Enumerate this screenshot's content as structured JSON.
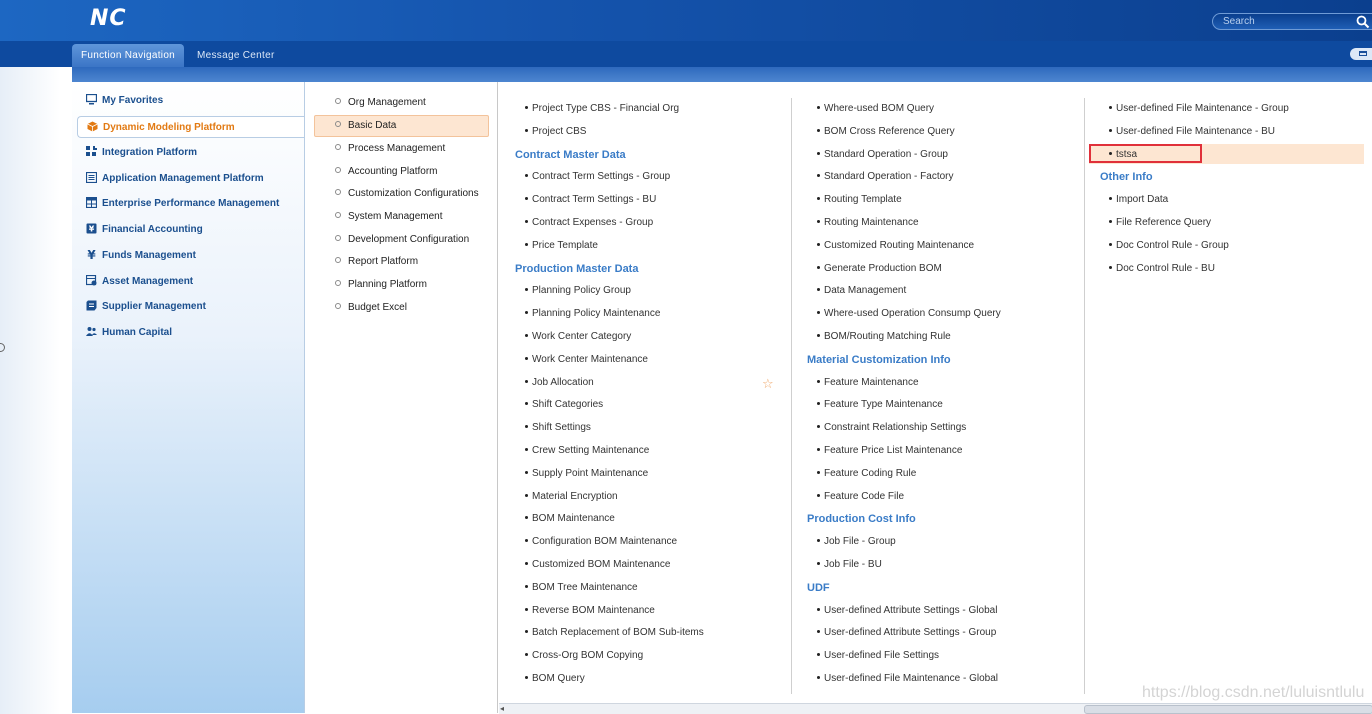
{
  "header": {
    "logo": "NC",
    "search": {
      "placeholder": "Search"
    }
  },
  "tabs": [
    {
      "label": "Function Navigation",
      "active": true
    },
    {
      "label": "Message Center",
      "active": false
    }
  ],
  "sidebar": {
    "items": [
      {
        "label": "My Favorites",
        "icon": "monitor-icon"
      },
      {
        "label": "Dynamic Modeling Platform",
        "icon": "cube-icon",
        "active": true
      },
      {
        "label": "Integration Platform",
        "icon": "integration-icon"
      },
      {
        "label": "Application Management Platform",
        "icon": "app-grid-icon"
      },
      {
        "label": "Enterprise Performance Management",
        "icon": "table-icon"
      },
      {
        "label": "Financial Accounting",
        "icon": "ledger-icon"
      },
      {
        "label": "Funds Management",
        "icon": "yen-icon"
      },
      {
        "label": "Asset Management",
        "icon": "asset-icon"
      },
      {
        "label": "Supplier Management",
        "icon": "supplier-icon"
      },
      {
        "label": "Human Capital",
        "icon": "people-icon"
      }
    ]
  },
  "subnav": {
    "items": [
      "Org Management",
      "Basic Data",
      "Process Management",
      "Accounting Platform",
      "Customization Configurations",
      "System Management",
      "Development Configuration",
      "Report Platform",
      "Planning Platform",
      "Budget Excel"
    ],
    "active_index": 1
  },
  "content": {
    "col1": [
      {
        "type": "item",
        "text": "Project Type CBS - Financial Org"
      },
      {
        "type": "item",
        "text": "Project CBS"
      },
      {
        "type": "head",
        "text": "Contract Master Data"
      },
      {
        "type": "item",
        "text": "Contract Term Settings - Group"
      },
      {
        "type": "item",
        "text": "Contract Term Settings - BU"
      },
      {
        "type": "item",
        "text": "Contract Expenses - Group"
      },
      {
        "type": "item",
        "text": "Price Template"
      },
      {
        "type": "head",
        "text": "Production Master Data"
      },
      {
        "type": "item",
        "text": "Planning Policy Group"
      },
      {
        "type": "item",
        "text": "Planning Policy Maintenance"
      },
      {
        "type": "item",
        "text": "Work Center Category"
      },
      {
        "type": "item",
        "text": "Work Center Maintenance"
      },
      {
        "type": "item",
        "text": "Job Allocation"
      },
      {
        "type": "item",
        "text": "Shift Categories"
      },
      {
        "type": "item",
        "text": "Shift Settings"
      },
      {
        "type": "item",
        "text": "Crew Setting Maintenance"
      },
      {
        "type": "item",
        "text": "Supply Point Maintenance"
      },
      {
        "type": "item",
        "text": "Material Encryption"
      },
      {
        "type": "item",
        "text": "BOM Maintenance"
      },
      {
        "type": "item",
        "text": "Configuration BOM Maintenance"
      },
      {
        "type": "item",
        "text": "Customized BOM Maintenance"
      },
      {
        "type": "item",
        "text": "BOM Tree Maintenance"
      },
      {
        "type": "item",
        "text": "Reverse BOM Maintenance"
      },
      {
        "type": "item",
        "text": "Batch Replacement of BOM Sub-items"
      },
      {
        "type": "item",
        "text": "Cross-Org BOM Copying"
      },
      {
        "type": "item",
        "text": "BOM Query"
      }
    ],
    "col2": [
      {
        "type": "item",
        "text": "Where-used BOM Query"
      },
      {
        "type": "item",
        "text": "BOM Cross Reference Query"
      },
      {
        "type": "item",
        "text": "Standard Operation - Group"
      },
      {
        "type": "item",
        "text": "Standard Operation - Factory"
      },
      {
        "type": "item",
        "text": "Routing Template"
      },
      {
        "type": "item",
        "text": "Routing Maintenance"
      },
      {
        "type": "item",
        "text": "Customized Routing Maintenance"
      },
      {
        "type": "item",
        "text": "Generate Production BOM"
      },
      {
        "type": "item",
        "text": "Data Management"
      },
      {
        "type": "item",
        "text": "Where-used Operation Consump Query"
      },
      {
        "type": "item",
        "text": "BOM/Routing Matching Rule"
      },
      {
        "type": "head",
        "text": "Material Customization Info"
      },
      {
        "type": "item",
        "text": "Feature Maintenance"
      },
      {
        "type": "item",
        "text": "Feature Type Maintenance"
      },
      {
        "type": "item",
        "text": "Constraint Relationship Settings"
      },
      {
        "type": "item",
        "text": "Feature Price List Maintenance"
      },
      {
        "type": "item",
        "text": "Feature Coding Rule"
      },
      {
        "type": "item",
        "text": "Feature Code File"
      },
      {
        "type": "head",
        "text": "Production Cost Info"
      },
      {
        "type": "item",
        "text": "Job File - Group"
      },
      {
        "type": "item",
        "text": "Job File - BU"
      },
      {
        "type": "head",
        "text": "UDF"
      },
      {
        "type": "item",
        "text": "User-defined Attribute Settings - Global"
      },
      {
        "type": "item",
        "text": "User-defined Attribute Settings - Group"
      },
      {
        "type": "item",
        "text": "User-defined File Settings"
      },
      {
        "type": "item",
        "text": "User-defined File Maintenance - Global"
      }
    ],
    "col3": [
      {
        "type": "item",
        "text": "User-defined File Maintenance - Group"
      },
      {
        "type": "item",
        "text": "User-defined File Maintenance - BU"
      },
      {
        "type": "item",
        "text": "tstsa",
        "highlighted": true
      },
      {
        "type": "head",
        "text": "Other Info"
      },
      {
        "type": "item",
        "text": "Import Data"
      },
      {
        "type": "item",
        "text": "File Reference Query"
      },
      {
        "type": "item",
        "text": "Doc Control Rule - Group"
      },
      {
        "type": "item",
        "text": "Doc Control Rule - BU"
      }
    ]
  },
  "watermark": "https://blog.csdn.net/luluisntlulu",
  "colors": {
    "header_blue": "#1554ad",
    "accent_orange": "#e27a13",
    "section_head": "#3a7cc7",
    "highlight_bg": "#fde6d2",
    "highlight_border": "#e0303a"
  }
}
